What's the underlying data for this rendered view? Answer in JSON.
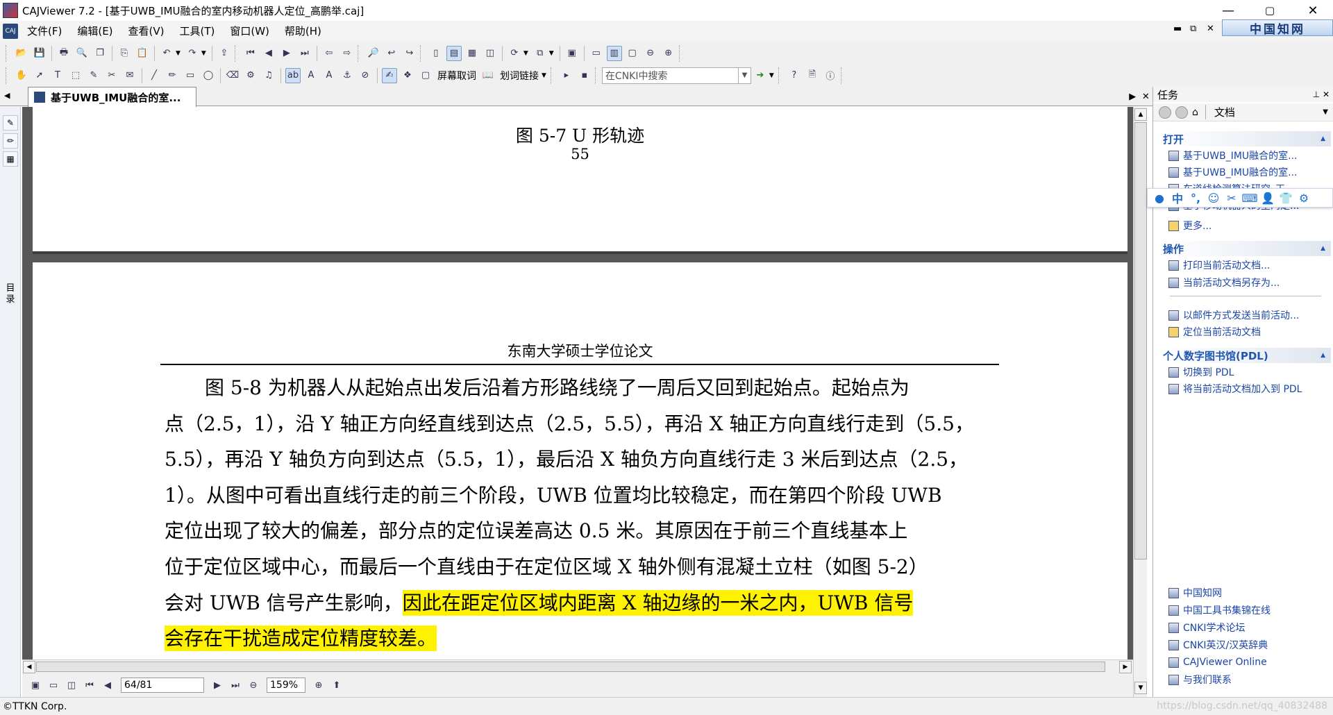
{
  "window": {
    "title": "CAJViewer 7.2 - [基于UWB_IMU融合的室内移动机器人定位_高鹏举.caj]",
    "min": "—",
    "max": "▢",
    "close": "✕"
  },
  "menu": [
    "文件(F)",
    "编辑(E)",
    "查看(V)",
    "工具(T)",
    "窗口(W)",
    "帮助(H)"
  ],
  "mdi": {
    "min": "▬",
    "restore": "⧉",
    "close": "✕"
  },
  "cnki_logo": "中国知网",
  "toolbar2": {
    "screen_word": "屏幕取词",
    "word_link": "划词链接",
    "search_placeholder": "在CNKI中搜索"
  },
  "tab": {
    "label": "基于UWB_IMU融合的室..."
  },
  "tabnav": {
    "prev": "◀",
    "next": "▶",
    "close": "✕"
  },
  "left_strip": {
    "label": "目录"
  },
  "page1": {
    "figure_caption": "图  5-7 U 形轨迹",
    "page_number": "55"
  },
  "page2": {
    "header": "东南大学硕士学位论文",
    "lines": [
      "图  5-8 为机器人从起始点出发后沿着方形路线绕了一周后又回到起始点。起始点为",
      "点（2.5，1），沿 Y 轴正方向经直线到达点（2.5，5.5），再沿 X 轴正方向直线行走到（5.5，",
      "5.5），再沿 Y 轴负方向到达点（5.5，1），最后沿 X 轴负方向直线行走 3 米后到达点（2.5，",
      "1）。从图中可看出直线行走的前三个阶段，UWB 位置均比较稳定，而在第四个阶段 UWB",
      "定位出现了较大的偏差，部分点的定位误差高达 0.5 米。其原因在于前三个直线基本上",
      "位于定位区域中心，而最后一个直线由于在定位区域 X 轴外侧有混凝土立柱（如图  5-2）",
      "会对 UWB 信号产生影响，"
    ],
    "highlight_1": "因此在距定位区域内距离 X 轴边缘的一米之内，UWB 信号",
    "highlight_2": "会存在干扰造成定位精度较差。"
  },
  "nav": {
    "page": "64/81",
    "zoom": "159%"
  },
  "taskpane": {
    "title": "任务",
    "doc_label": "文档",
    "open_header": "打开",
    "open_items": [
      "基于UWB_IMU融合的室...",
      "基于UWB_IMU融合的室...",
      "车道线检测算法研究_王...",
      "基于移动机器人的室内定..."
    ],
    "more": "更多...",
    "ops_header": "操作",
    "ops_items": [
      "打印当前活动文档...",
      "当前活动文档另存为...",
      "以邮件方式发送当前活动...",
      "定位当前活动文档"
    ],
    "pdl_header": "个人数字图书馆(PDL)",
    "pdl_items": [
      "切换到 PDL",
      "将当前活动文档加入到 PDL"
    ],
    "links": [
      "中国知网",
      "中国工具书集锦在线",
      "CNKI学术论坛",
      "CNKI英汉/汉英辞典",
      "CAJViewer Online",
      "与我们联系"
    ]
  },
  "ime": {
    "lang": "中",
    "punct": "°,"
  },
  "status": {
    "copyright": "©TTKN Corp.",
    "watermark": "https://blog.csdn.net/qq_40832488"
  },
  "colors": {
    "highlight": "#fff200",
    "link": "#1a44a8",
    "page_bg": "#575757"
  }
}
